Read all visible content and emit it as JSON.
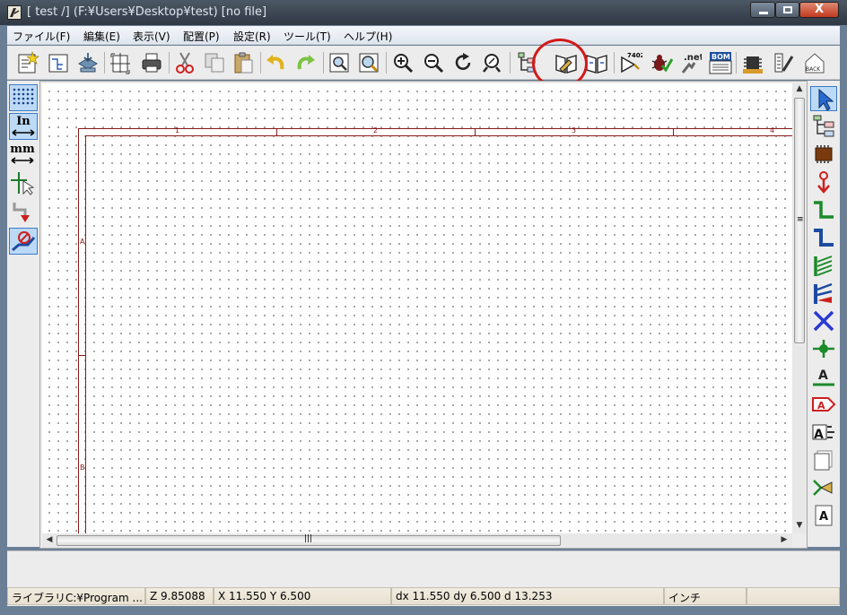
{
  "window": {
    "title": "[ test /] (F:¥Users¥Desktop¥test) [no file]",
    "close_glyph": "X"
  },
  "menu": [
    {
      "label": "ファイル(F)"
    },
    {
      "label": "編集(E)"
    },
    {
      "label": "表示(V)"
    },
    {
      "label": "配置(P)"
    },
    {
      "label": "設定(R)"
    },
    {
      "label": "ツール(T)"
    },
    {
      "label": "ヘルプ(H)"
    }
  ],
  "toolbar": {
    "icons": [
      "new-sheet-icon",
      "hierarchy-icon",
      "save-icon",
      "page-settings-icon",
      "print-icon",
      "cut-icon",
      "copy-icon",
      "paste-icon",
      "undo-icon",
      "redo-icon",
      "find-icon",
      "find-replace-icon",
      "zoom-in-icon",
      "zoom-out-icon",
      "zoom-redraw-icon",
      "zoom-fit-icon",
      "navigator-icon",
      "library-editor-icon",
      "library-browser-icon",
      "annotate-icon",
      "erc-icon",
      "netlist-icon",
      "cvpcb-icon",
      "bom-icon",
      "pcbnew-icon",
      "import-footprint-icon",
      "back-annotate-icon"
    ],
    "annotate_label": "7402",
    "netlist_label": ".net",
    "bom_label": "BOM",
    "back_label": "BACK"
  },
  "left_toolbar": {
    "inch_label": "In",
    "mm_label": "mm"
  },
  "right_toolbar": {
    "text_tool_label": "A"
  },
  "sheet": {
    "col_labels": [
      "1",
      "2",
      "3",
      "4"
    ],
    "row_labels": [
      "A",
      "B"
    ]
  },
  "colors": {
    "sheet_border": "#8a1a1a",
    "highlight": "#d11a1a",
    "active_tool": "#bcd9f5"
  },
  "status": {
    "library": "ライブラリC:¥Program ...",
    "zoom": "Z 9.85088",
    "cursor": "X 11.550  Y 6.500",
    "delta": "dx 11.550  dy 6.500  d 13.253",
    "units": "インチ"
  }
}
